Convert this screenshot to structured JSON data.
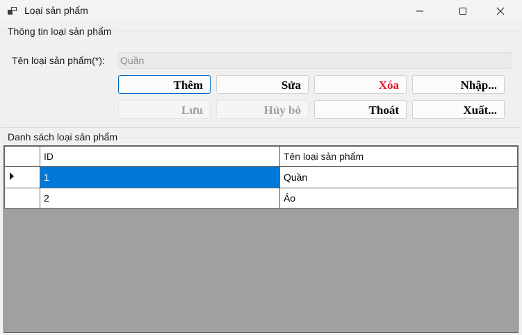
{
  "window": {
    "title": "Loại sản phẩm",
    "icons": {
      "app": "app-window-icon",
      "minimize": "minimize-icon",
      "maximize": "maximize-icon",
      "close": "close-icon"
    }
  },
  "info_group": {
    "title": "Thông tin loại sản phẩm",
    "name_label": "Tên loại sản phẩm(*):",
    "name_value": "Quần"
  },
  "buttons": {
    "add": "Thêm",
    "edit": "Sửa",
    "delete": "Xóa",
    "import": "Nhập...",
    "save": "Lưu",
    "cancel": "Hủy bỏ",
    "exit": "Thoát",
    "export": "Xuất..."
  },
  "list_group": {
    "title": "Danh sách loại sản phẩm",
    "columns": [
      "ID",
      "Tên loại sản phẩm"
    ],
    "rows": [
      {
        "id": "1",
        "name": "Quần"
      },
      {
        "id": "2",
        "name": "Áo"
      }
    ]
  },
  "colors": {
    "accent": "#0078d7",
    "danger": "#e81123",
    "grid_background": "#a0a0a0"
  }
}
